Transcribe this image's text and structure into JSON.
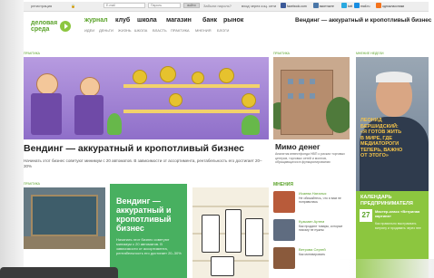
{
  "topbar": {
    "register": "регистрация",
    "email_placeholder": "E-mail",
    "password_placeholder": "Пароль",
    "login_button": "войти",
    "forgot": "Забыли пароль?",
    "social_prompt": "вход через соц. сети",
    "networks": [
      {
        "label": "facebook.com",
        "color": "#3b5998"
      },
      {
        "label": "вконтакте",
        "color": "#4a76a8"
      },
      {
        "label": "twit",
        "color": "#2aa9e0"
      },
      {
        "label": "mail.ru",
        "color": "#168de2"
      },
      {
        "label": "одноклассники",
        "color": "#f4731c"
      }
    ]
  },
  "logo": {
    "line1": "деловая",
    "line2": "среда",
    "color": "#5aa229"
  },
  "nav": {
    "main": [
      {
        "label": "журнал",
        "color": "#5aa229"
      },
      {
        "label": "клуб",
        "color": "#222222"
      },
      {
        "label": "школа",
        "color": "#222222"
      },
      {
        "label": "магазин",
        "color": "#222222"
      },
      {
        "label": "банк",
        "color": "#222222"
      },
      {
        "label": "рынок",
        "color": "#222222"
      }
    ],
    "sub": [
      "идеи",
      "деньги",
      "жизнь",
      "школа",
      "власть",
      "практика",
      "мнения",
      "блоги"
    ]
  },
  "tagline": "Вендинг — аккуратный и кропотливый бизнес",
  "hero": {
    "section": "практика",
    "title": "Вендинг — аккуратный и кропотливый бизнес",
    "lead": "Начинать этот бизнес советуют минимум с 20 автоматов. В зависимости от ассортимента, рентабельность его достигает 20–30%"
  },
  "second": {
    "section": "практика",
    "title": "Мимо денег",
    "lead": "Аналитик инвестфонда НВП о рисках торговых центров, торговых сетей и моллов, обращающихся в функционировании"
  },
  "interview": {
    "section": "мнение недели",
    "quote_lines": [
      "Леонид",
      "Бершидский:",
      "«Я готов жить",
      "в мире, где",
      "медиатороги",
      "теперь, важно",
      "от этого»"
    ]
  },
  "row2": {
    "section": "практика",
    "green_title_lines": [
      "Вендинг —",
      "аккуратный и",
      "кропотливый",
      "бизнес"
    ],
    "green_lead": "Начинать этот бизнес советуют минимум с 20 автоматов. В зависимости от ассортимента, рентабельность его достигает 20–30%"
  },
  "opinions": {
    "heading": "мнения",
    "items": [
      {
        "name": "Исаева Наталья",
        "text": "Не обижайтесь, что я вам не понравилась",
        "color": "#b85b3a"
      },
      {
        "name": "Кузьмин Артем",
        "text": "Как продают товары, которые никому не нужны",
        "color": "#5f6c80"
      },
      {
        "name": "Ветрова Сергей",
        "text": "Как мотивировать",
        "color": "#8a5a3c"
      }
    ]
  },
  "calendar": {
    "heading_lines": [
      "календарь",
      "предпринимателя"
    ],
    "date": "27",
    "event": "Мастер-класс «Ветриная картина»",
    "event_desc": "Как правильно выстраивать витрину и продавать через нее"
  }
}
